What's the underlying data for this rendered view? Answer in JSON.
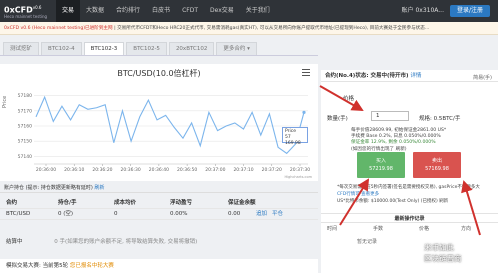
{
  "app": {
    "name": "0xCFD",
    "version": "v0.6",
    "subtitle": "Heco mainnet testing"
  },
  "nav": [
    "交易",
    "大数据",
    "合约排行",
    "白皮书",
    "CFDT",
    "Dex交易",
    "关于我们"
  ],
  "account": "账户 0x310A...",
  "login_label": "登录/注册",
  "notice": {
    "lead": "0xCFD v0.6 (Heco mainnet testing)已进阶到主网",
    "body": "| 交易所代币CFDT和Heco HRC20正式代币, 交易需消耗gas(真实HT), 可以从交易所向你账户提取代币地址(已提现到Heco), 目前大赛处于全民参与状态..."
  },
  "tabs": [
    "测试挖矿",
    "BTC102-4",
    "BTC102-3",
    "BTC102-5",
    "20xBTC102",
    "更多合约 ▾"
  ],
  "active_tab_index": 2,
  "chart_data": {
    "type": "line",
    "title": "BTC/USD(10.0倍杠杆)",
    "ylabel": "Price",
    "x": [
      "20:36:00",
      "20:36:10",
      "20:36:20",
      "20:36:30",
      "20:36:40",
      "20:36:50",
      "20:37:00",
      "20:37:10",
      "20:37:20",
      "20:37:30"
    ],
    "y_ticks": [
      57140,
      57150,
      57160,
      57170,
      57180
    ],
    "ylim": [
      57135,
      57185
    ],
    "values": [
      57166,
      57179,
      57163,
      57173,
      57164,
      57174,
      57171,
      57172,
      57174,
      57149,
      57170,
      57150,
      57166,
      57177,
      57164,
      57167,
      57159,
      57152,
      57162,
      57147,
      57169,
      57157,
      57160,
      57162,
      57158,
      57169,
      57154,
      57168,
      57146,
      57142,
      57148,
      57169
    ],
    "tooltip": {
      "label": "Price",
      "value": "57 169.98"
    },
    "credit": "Highcharts.com"
  },
  "positions": {
    "header": "账户持仓 (提示: 持仓数据更新略有延时)",
    "header_link": "刷新",
    "columns": [
      "合约",
      "持仓/手",
      "成本均价",
      "浮动盈亏",
      "保证金余额"
    ],
    "row": {
      "contract": "BTC/USD",
      "qty": "0 (空)",
      "avg": "0",
      "pnl": "0.00%",
      "margin": "0.00",
      "actions": [
        "追加",
        "平仓"
      ]
    },
    "settle_label": "结算中",
    "settle_note": "0 手(如果您的账户余额不足, 将导致结算失败, 交易将撤销)"
  },
  "competition": {
    "label": "模拟交易大赛: 当前第5轮",
    "status": "您已报名中轮大赛"
  },
  "side": {
    "header": "合约(No.4)状态: 交易中(待开市)",
    "header_link": "详情",
    "control": "简易(手)",
    "price_label": "价格",
    "qty_label": "数量(手)",
    "qty_value": "1",
    "spec": "规格: 0.5BTC/手",
    "info": [
      "每手价值28609.99, 初始保证金2861.00 US*",
      "手续费 Base 0.2%, 日息 0.050%/0.000%",
      "保证金率 12.9%, 剩余 0.050%/0.000%",
      "(如因您的行情出现了 刷新)"
    ],
    "buy": {
      "label": "买入",
      "price": "57219.98"
    },
    "sell": {
      "label": "卖出",
      "price": "57169.98"
    },
    "notes": [
      "*每次交易需要在5秒内签署(签名是需要授权交易), gasPrice不需要多大",
      "CFD行情可 查看更多",
      "US*比特币余额: $10000.00(Test Only) (已授权) 刷新"
    ],
    "records_title": "最新操作记录",
    "records_cols": [
      "时间",
      "手数",
      "价格",
      "方向"
    ],
    "records_empty": "暂无记录"
  },
  "watermark": {
    "line1": "米币如此",
    "line2": "区块链晋商"
  },
  "colors": {
    "nav": "#2f3338",
    "buy": "#62b66a",
    "sell": "#d9534f",
    "accent": "#2b79c2",
    "arrow": "#d0312d"
  }
}
